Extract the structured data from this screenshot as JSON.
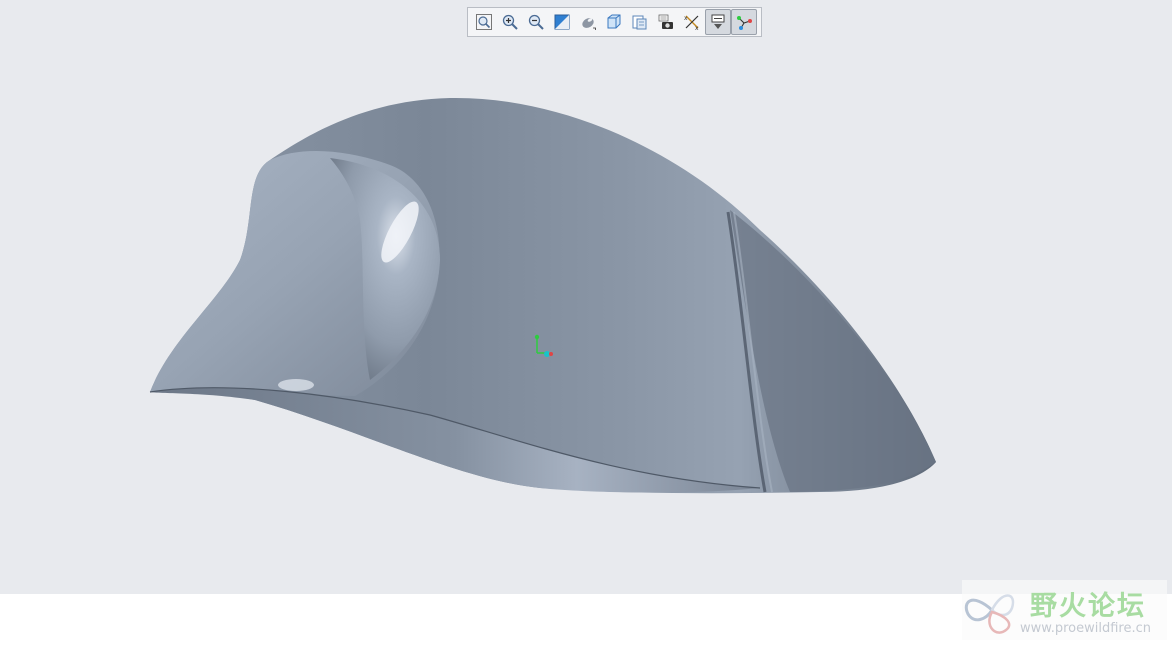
{
  "viewport": {
    "background": "#e8eaee",
    "model_color": "#8a96a6"
  },
  "toolbar": {
    "buttons": [
      {
        "name": "refit-button",
        "icon": "zoom-fit-icon",
        "active": false
      },
      {
        "name": "zoom-in-button",
        "icon": "zoom-in-icon",
        "active": false
      },
      {
        "name": "zoom-out-button",
        "icon": "zoom-out-icon",
        "active": false
      },
      {
        "name": "repaint-button",
        "icon": "repaint-icon",
        "active": false
      },
      {
        "name": "display-style-button",
        "icon": "display-style-icon",
        "active": false
      },
      {
        "name": "saved-orientations-button",
        "icon": "cube-view-icon",
        "active": false
      },
      {
        "name": "view-manager-button",
        "icon": "view-manager-icon",
        "active": false
      },
      {
        "name": "perspective-view-button",
        "icon": "camera-icon",
        "active": false
      },
      {
        "name": "datum-display-button",
        "icon": "datum-display-icon",
        "active": false
      },
      {
        "name": "annotation-display-button",
        "icon": "annotation-display-icon",
        "active": true
      },
      {
        "name": "spin-center-button",
        "icon": "spin-center-icon",
        "active": true
      }
    ]
  },
  "watermark": {
    "title": "野火论坛",
    "url": "www.proewildfire.cn",
    "title_color": "#a8dca2"
  }
}
